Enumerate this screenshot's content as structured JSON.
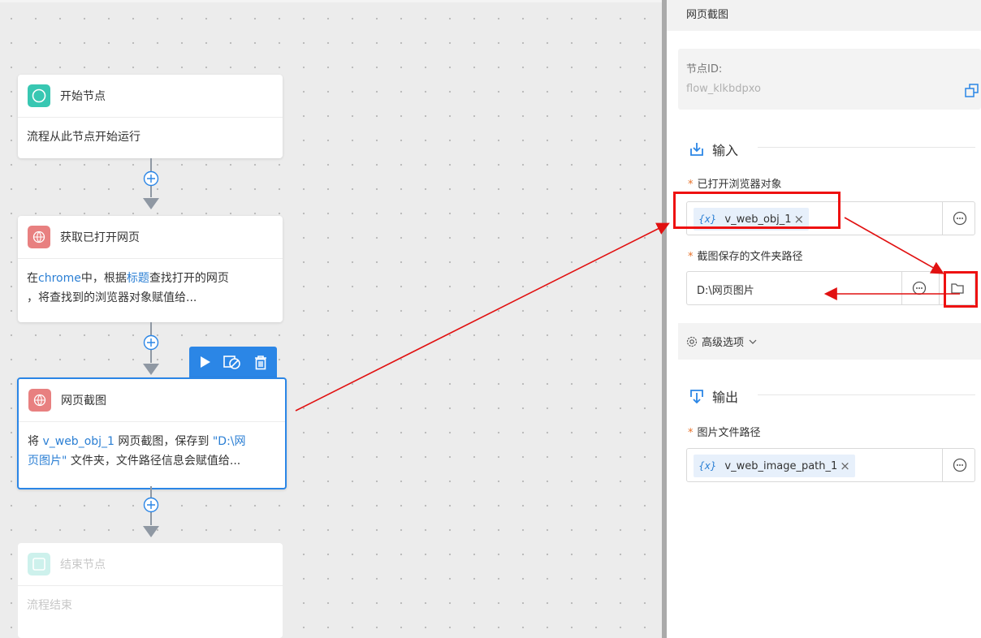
{
  "canvas": {
    "nodes": [
      {
        "title": "开始节点",
        "desc": "流程从此节点开始运行",
        "icon": "circle-icon"
      },
      {
        "title": "获取已打开网页",
        "desc_parts": [
          "在",
          "chrome",
          "中，根据",
          "标题",
          "查找打开的网页"
        ],
        "desc_line2": "，将查找到的浏览器对象赋值给...",
        "icon": "globe-icon"
      },
      {
        "title": "网页截图",
        "desc_parts": [
          "将 ",
          "v_web_obj_1",
          " 网页截图，保存到 ",
          "\"D:\\网",
          ""
        ],
        "desc_line2_parts": [
          "页图片\"",
          " 文件夹，文件路径信息会赋值给..."
        ],
        "icon": "globe-icon"
      },
      {
        "title": "结束节点",
        "desc": "流程结束",
        "icon": "square-icon"
      }
    ],
    "toolbar": {
      "icons": [
        "play-icon",
        "disable-icon",
        "trash-icon"
      ]
    }
  },
  "panel": {
    "title": "网页截图",
    "node_id_label": "节点ID:",
    "node_id_value": "flow_klkbdpxo",
    "input_section": "输入",
    "browser_label": "已打开浏览器对象",
    "browser_var": "v_web_obj_1",
    "path_label": "截图保存的文件夹路径",
    "path_value": "D:\\网页图片",
    "advanced": "高级选项",
    "output_section": "输出",
    "image_path_label": "图片文件路径",
    "image_path_var": "v_web_image_path_1",
    "var_symbol": "{x}",
    "remove_symbol": "×",
    "required_mark": "*"
  },
  "colors": {
    "accent": "#2b86e6",
    "annotation_red": "#e11111",
    "start_icon": "#38c7b2",
    "globe_icon": "#e88080"
  }
}
